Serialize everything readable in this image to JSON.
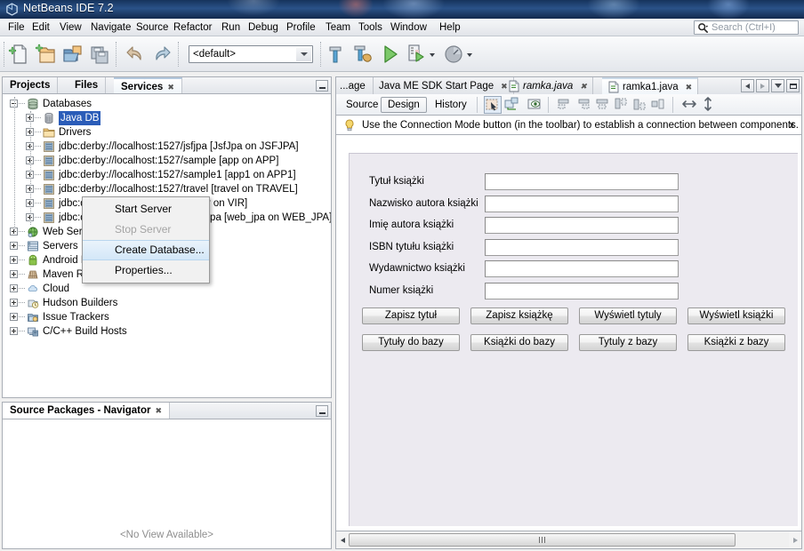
{
  "window": {
    "title": "NetBeans IDE 7.2",
    "app_icon": "netbeans-cube-icon"
  },
  "menubar": {
    "items": [
      {
        "label": "File"
      },
      {
        "label": "Edit"
      },
      {
        "label": "View"
      },
      {
        "label": "Navigate"
      },
      {
        "label": "Source"
      },
      {
        "label": "Refactor"
      },
      {
        "label": "Run"
      },
      {
        "label": "Debug"
      },
      {
        "label": "Profile"
      },
      {
        "label": "Team"
      },
      {
        "label": "Tools"
      },
      {
        "label": "Window"
      },
      {
        "label": "Help"
      }
    ],
    "search_placeholder": "Search (Ctrl+I)",
    "search_value": ""
  },
  "toolbar": {
    "buttons": [
      {
        "name": "new-file-icon",
        "title": "New File"
      },
      {
        "name": "new-project-icon",
        "title": "New Project"
      },
      {
        "name": "open-project-icon",
        "title": "Open Project"
      },
      {
        "name": "save-all-icon",
        "title": "Save All"
      },
      {
        "name": "undo-icon",
        "title": "Undo"
      },
      {
        "name": "redo-icon",
        "title": "Redo"
      },
      {
        "name": "build-project-icon",
        "title": "Build Project"
      },
      {
        "name": "clean-build-icon",
        "title": "Clean and Build Project"
      },
      {
        "name": "run-project-icon",
        "title": "Run Project"
      },
      {
        "name": "debug-project-icon",
        "title": "Debug Project"
      },
      {
        "name": "profile-project-icon",
        "title": "Profile Project"
      }
    ],
    "config_value": "<default>"
  },
  "left_pane": {
    "tabs": [
      {
        "label": "Projects",
        "active": false,
        "closable": false
      },
      {
        "label": "Files",
        "active": false,
        "closable": false
      },
      {
        "label": "Services",
        "active": true,
        "closable": true
      }
    ],
    "tree": [
      {
        "id": "databases",
        "label": "Databases",
        "depth": 0,
        "expander": "minus",
        "icon": "database-stack-icon",
        "selected": false
      },
      {
        "id": "javadb",
        "label": "Java DB",
        "depth": 1,
        "expander": "plus",
        "icon": "database-icon",
        "selected": true
      },
      {
        "id": "drivers",
        "label": "Drivers",
        "depth": 1,
        "expander": "plus",
        "icon": "folder-drivers-icon",
        "selected": false
      },
      {
        "id": "jdbc-jsfjpa",
        "label": "jdbc:derby://localhost:1527/jsfjpa [JsfJpa on JSFJPA]",
        "depth": 1,
        "expander": "plus",
        "icon": "jdbc-connection-icon",
        "selected": false
      },
      {
        "id": "jdbc-app",
        "label": "jdbc:derby://localhost:1527/sample [app on APP]",
        "depth": 1,
        "expander": "plus",
        "icon": "jdbc-connection-icon",
        "selected": false
      },
      {
        "id": "jdbc-app1",
        "label": "jdbc:derby://localhost:1527/sample1 [app1 on APP1]",
        "depth": 1,
        "expander": "plus",
        "icon": "jdbc-connection-icon",
        "selected": false
      },
      {
        "id": "jdbc-travel",
        "label": "jdbc:derby://localhost:1527/travel [travel on TRAVEL]",
        "depth": 1,
        "expander": "plus",
        "icon": "jdbc-connection-icon",
        "selected": false
      },
      {
        "id": "jdbc-vir",
        "label": "jdbc:derby://localhost:1527/vir [vir on VIR]",
        "depth": 1,
        "expander": "plus",
        "icon": "jdbc-connection-icon",
        "selected": false
      },
      {
        "id": "jdbc-webjpa",
        "label": "jdbc:derby://localhost:1527/web_jpa [web_jpa on WEB_JPA]",
        "depth": 1,
        "expander": "plus",
        "icon": "jdbc-connection-icon",
        "selected": false
      },
      {
        "id": "webservices",
        "label": "Web Services",
        "depth": 0,
        "expander": "plus",
        "icon": "web-services-icon",
        "selected": false
      },
      {
        "id": "servers",
        "label": "Servers",
        "depth": 0,
        "expander": "plus",
        "icon": "servers-icon",
        "selected": false
      },
      {
        "id": "android",
        "label": "Android Devices",
        "depth": 0,
        "expander": "plus",
        "icon": "android-icon",
        "selected": false
      },
      {
        "id": "maven",
        "label": "Maven Repositories",
        "depth": 0,
        "expander": "plus",
        "icon": "maven-icon",
        "selected": false
      },
      {
        "id": "cloud",
        "label": "Cloud",
        "depth": 0,
        "expander": "plus",
        "icon": "cloud-icon",
        "selected": false
      },
      {
        "id": "hudson",
        "label": "Hudson Builders",
        "depth": 0,
        "expander": "plus",
        "icon": "hudson-icon",
        "selected": false
      },
      {
        "id": "issues",
        "label": "Issue Trackers",
        "depth": 0,
        "expander": "plus",
        "icon": "issue-tracker-icon",
        "selected": false
      },
      {
        "id": "cpp",
        "label": "C/C++ Build Hosts",
        "depth": 0,
        "expander": "plus",
        "icon": "build-host-icon",
        "selected": false
      }
    ]
  },
  "context_menu": {
    "items": [
      {
        "label": "Start Server",
        "state": "normal"
      },
      {
        "label": "Stop Server",
        "state": "disabled"
      },
      {
        "label": "Create Database...",
        "state": "hover"
      },
      {
        "label": "Properties...",
        "state": "normal"
      }
    ]
  },
  "navigator": {
    "tab_label": "Source Packages - Navigator",
    "empty_text": "<No View Available>"
  },
  "editor": {
    "tabs": [
      {
        "label": "...age",
        "active": false,
        "closable": false,
        "italic": false,
        "icon": null
      },
      {
        "label": "Java ME SDK Start Page",
        "active": false,
        "closable": true,
        "italic": false,
        "icon": null
      },
      {
        "label": "ramka.java",
        "active": false,
        "closable": true,
        "italic": true,
        "icon": "java-file-icon"
      },
      {
        "label": "ramka1.java",
        "active": true,
        "closable": true,
        "italic": false,
        "icon": "java-file-icon"
      }
    ],
    "view_tabs": [
      {
        "label": "Source",
        "active": false
      },
      {
        "label": "Design",
        "active": true
      },
      {
        "label": "History",
        "active": false
      }
    ],
    "design_tools": [
      {
        "name": "selection-mode-icon",
        "active": true
      },
      {
        "name": "connection-mode-icon",
        "active": false
      },
      {
        "name": "preview-design-icon",
        "active": false
      },
      {
        "name": "align-left-icon",
        "active": false
      },
      {
        "name": "align-right-icon",
        "active": false
      },
      {
        "name": "align-center-h-icon",
        "active": false
      },
      {
        "name": "align-top-icon",
        "active": false
      },
      {
        "name": "align-bottom-icon",
        "active": false
      },
      {
        "name": "align-center-v-icon",
        "active": false
      },
      {
        "name": "resize-horizontal-icon",
        "active": false
      },
      {
        "name": "resize-vertical-icon",
        "active": false
      }
    ],
    "hint": {
      "icon": "lightbulb-icon",
      "text": "Use the Connection Mode button (in the toolbar) to establish a connection between components.",
      "close_label": "x"
    }
  },
  "form": {
    "fields": [
      {
        "label": "Tytuł książki",
        "value": ""
      },
      {
        "label": "Nazwisko autora książki",
        "value": ""
      },
      {
        "label": "Imię autora książki",
        "value": ""
      },
      {
        "label": "ISBN tytułu książki",
        "value": ""
      },
      {
        "label": "Wydawnictwo książki",
        "value": ""
      },
      {
        "label": "Numer książki",
        "value": ""
      }
    ],
    "buttons_row1": [
      {
        "label": "Zapisz tytuł"
      },
      {
        "label": "Zapisz książkę"
      },
      {
        "label": "Wyświetl tytuly"
      },
      {
        "label": "Wyświetl książki"
      }
    ],
    "buttons_row2": [
      {
        "label": "Tytuły do bazy"
      },
      {
        "label": "Książki do bazy"
      },
      {
        "label": "Tytuly z bazy"
      },
      {
        "label": "Książki z bazy"
      }
    ]
  },
  "colors": {
    "titlebar": "#1b3a68",
    "selection": "#2a5cb8",
    "menu_hover": "#d3e7f8",
    "form_bg": "#eceaf0",
    "panel_border": "#a9aeb6"
  }
}
